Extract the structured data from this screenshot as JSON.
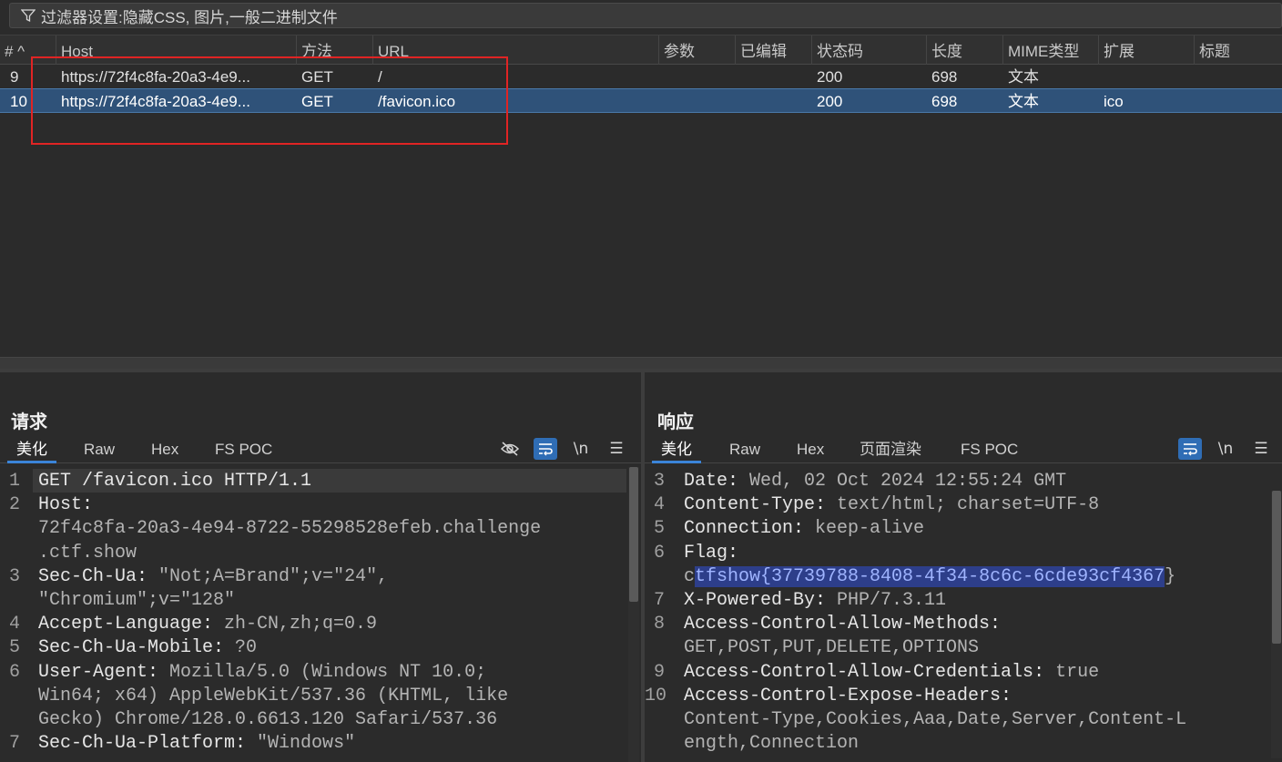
{
  "filter": {
    "text": "过滤器设置:隐藏CSS, 图片,一般二进制文件"
  },
  "table": {
    "columns": [
      "# ^",
      "Host",
      "方法",
      "URL",
      "参数",
      "已编辑",
      "状态码",
      "长度",
      "MIME类型",
      "扩展",
      "标题"
    ],
    "rows": [
      {
        "num": "9",
        "host": "https://72f4c8fa-20a3-4e9...",
        "method": "GET",
        "url": "/",
        "status": "200",
        "length": "698",
        "mime": "文本",
        "ext": ""
      },
      {
        "num": "10",
        "host": "https://72f4c8fa-20a3-4e9...",
        "method": "GET",
        "url": "/favicon.ico",
        "status": "200",
        "length": "698",
        "mime": "文本",
        "ext": "ico"
      }
    ],
    "selected_row": 1,
    "highlight_color": "#e02424"
  },
  "request": {
    "title": "请求",
    "tabs": [
      "美化",
      "Raw",
      "Hex",
      "FS POC"
    ],
    "active_tab": "美化",
    "lines": [
      {
        "n": "1",
        "segments": [
          {
            "t": "GET /favicon.ico HTTP/1.1",
            "c": "key"
          }
        ]
      },
      {
        "n": "2",
        "segments": [
          {
            "t": "Host:",
            "c": "key"
          }
        ]
      },
      {
        "n": "",
        "segments": [
          {
            "t": "72f4c8fa-20a3-4e94-8722-55298528efeb.challenge",
            "c": "val"
          }
        ]
      },
      {
        "n": "",
        "segments": [
          {
            "t": ".ctf.show",
            "c": "val"
          }
        ]
      },
      {
        "n": "3",
        "segments": [
          {
            "t": "Sec-Ch-Ua:",
            "c": "key"
          },
          {
            "t": " \"Not;A=Brand\";v=\"24\",",
            "c": "val"
          }
        ]
      },
      {
        "n": "",
        "segments": [
          {
            "t": "\"Chromium\";v=\"128\"",
            "c": "val"
          }
        ]
      },
      {
        "n": "4",
        "segments": [
          {
            "t": "Accept-Language:",
            "c": "key"
          },
          {
            "t": " zh-CN,zh;q=0.9",
            "c": "val"
          }
        ]
      },
      {
        "n": "5",
        "segments": [
          {
            "t": "Sec-Ch-Ua-Mobile:",
            "c": "key"
          },
          {
            "t": " ?0",
            "c": "val"
          }
        ]
      },
      {
        "n": "6",
        "segments": [
          {
            "t": "User-Agent:",
            "c": "key"
          },
          {
            "t": " Mozilla/5.0 (Windows NT 10.0;",
            "c": "val"
          }
        ]
      },
      {
        "n": "",
        "segments": [
          {
            "t": "Win64; x64) AppleWebKit/537.36 (KHTML, like",
            "c": "val"
          }
        ]
      },
      {
        "n": "",
        "segments": [
          {
            "t": "Gecko) Chrome/128.0.6613.120 Safari/537.36",
            "c": "val"
          }
        ]
      },
      {
        "n": "7",
        "segments": [
          {
            "t": "Sec-Ch-Ua-Platform:",
            "c": "key"
          },
          {
            "t": " \"Windows\"",
            "c": "val"
          }
        ]
      }
    ]
  },
  "response": {
    "title": "响应",
    "tabs": [
      "美化",
      "Raw",
      "Hex",
      "页面渲染",
      "FS POC"
    ],
    "active_tab": "美化",
    "lines": [
      {
        "n": "3",
        "segments": [
          {
            "t": "Date:",
            "c": "key"
          },
          {
            "t": " Wed, 02 Oct 2024 12:55:24 GMT",
            "c": "val"
          }
        ]
      },
      {
        "n": "4",
        "segments": [
          {
            "t": "Content-Type:",
            "c": "key"
          },
          {
            "t": " text/html; charset=UTF-8",
            "c": "val"
          }
        ]
      },
      {
        "n": "5",
        "segments": [
          {
            "t": "Connection:",
            "c": "key"
          },
          {
            "t": " keep-alive",
            "c": "val"
          }
        ]
      },
      {
        "n": "6",
        "segments": [
          {
            "t": "Flag:",
            "c": "key"
          }
        ]
      },
      {
        "n": "",
        "segments": [
          {
            "t": "c",
            "c": "val"
          },
          {
            "t": "tfshow{37739788-8408-4f34-8c6c-6cde93cf4367",
            "c": "flag"
          },
          {
            "t": "}",
            "c": "val"
          }
        ]
      },
      {
        "n": "7",
        "segments": [
          {
            "t": "X-Powered-By:",
            "c": "key"
          },
          {
            "t": " PHP/7.3.11",
            "c": "val"
          }
        ]
      },
      {
        "n": "8",
        "segments": [
          {
            "t": "Access-Control-Allow-Methods:",
            "c": "key"
          }
        ]
      },
      {
        "n": "",
        "segments": [
          {
            "t": "GET,POST,PUT,DELETE,OPTIONS",
            "c": "val"
          }
        ]
      },
      {
        "n": "9",
        "segments": [
          {
            "t": "Access-Control-Allow-Credentials:",
            "c": "key"
          },
          {
            "t": " true",
            "c": "val"
          }
        ]
      },
      {
        "n": "10",
        "segments": [
          {
            "t": "Access-Control-Expose-Headers:",
            "c": "key"
          }
        ]
      },
      {
        "n": "",
        "segments": [
          {
            "t": "Content-Type,Cookies,Aaa,Date,Server,Content-L",
            "c": "val"
          }
        ]
      },
      {
        "n": "",
        "segments": [
          {
            "t": "ength,Connection",
            "c": "val"
          }
        ]
      }
    ]
  },
  "colors": {
    "accent": "#3b84d8",
    "selected_row": "#2f5279",
    "flag_highlight": "#2d3e8a"
  },
  "icons": [
    "filter-icon",
    "hide-icon",
    "wrap-icon",
    "newline-icon",
    "menu-icon",
    "split-horizontal-icon",
    "split-vertical-icon",
    "single-pane-icon"
  ]
}
